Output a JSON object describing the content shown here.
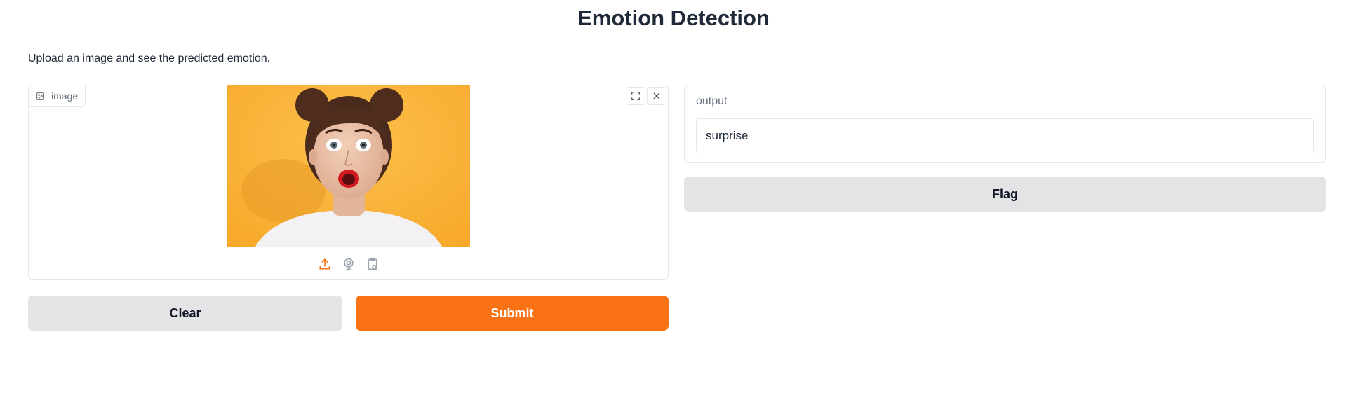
{
  "app": {
    "title": "Emotion Detection",
    "description": "Upload an image and see the predicted emotion."
  },
  "input": {
    "label": "image",
    "label_icon": "image-icon",
    "tools": [
      "fullscreen-icon",
      "close-icon"
    ],
    "sources": [
      "upload-icon",
      "webcam-icon",
      "clipboard-icon"
    ],
    "active_source": "upload"
  },
  "buttons": {
    "clear": "Clear",
    "submit": "Submit",
    "flag": "Flag"
  },
  "output": {
    "label": "output",
    "value": "surprise"
  },
  "colors": {
    "accent": "#f97316",
    "secondary_button": "#e4e4e7",
    "photo_background": "#fbb03b"
  }
}
